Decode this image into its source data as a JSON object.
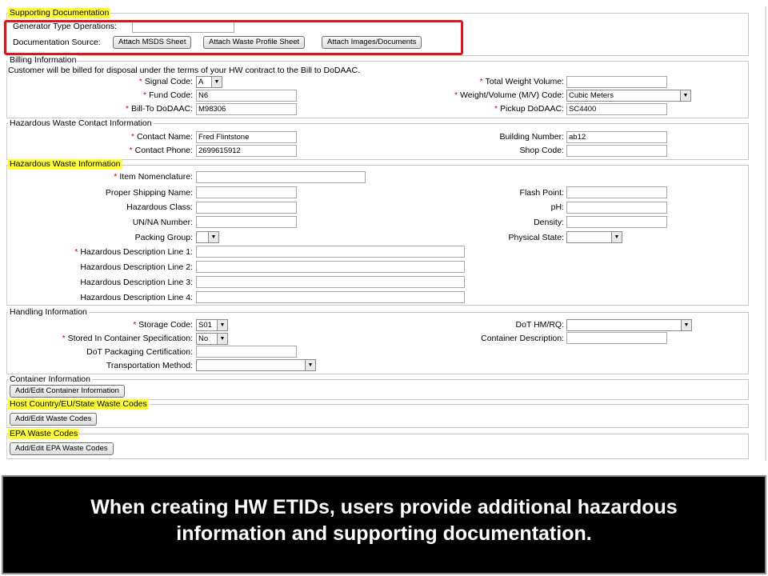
{
  "supporting": {
    "title": "Supporting Documentation",
    "generator_label": "Generator Type Operations:",
    "generator_value": "",
    "doc_source_label": "Documentation Source:",
    "attach_msds": "Attach MSDS Sheet",
    "attach_waste_profile": "Attach Waste Profile Sheet",
    "attach_images": "Attach Images/Documents"
  },
  "billing": {
    "title": "Billing Information",
    "note": "Customer will be billed for disposal under the terms of your HW contract to the Bill to DoDAAC.",
    "signal_code_label": "Signal Code:",
    "signal_code_value": "A",
    "fund_code_label": "Fund Code:",
    "fund_code_value": "N6",
    "bill_to_label": "Bill-To DoDAAC:",
    "bill_to_value": "M98306",
    "total_weight_label": "Total Weight Volume:",
    "total_weight_value": "",
    "weight_code_label": "Weight/Volume (M/V) Code:",
    "weight_code_value": "Cubic Meters",
    "pickup_label": "Pickup DoDAAC:",
    "pickup_value": "SC4400"
  },
  "contact": {
    "title": "Hazardous Waste Contact Information",
    "name_label": "Contact Name:",
    "name_value": "Fred Flintstone",
    "phone_label": "Contact Phone:",
    "phone_value": "2699615912",
    "building_label": "Building Number:",
    "building_value": "ab12",
    "shop_label": "Shop Code:",
    "shop_value": ""
  },
  "hw_info": {
    "title": "Hazardous Waste Information",
    "item_nomenclature_label": "Item Nomenclature:",
    "proper_shipping_label": "Proper Shipping Name:",
    "hazardous_class_label": "Hazardous Class:",
    "un_na_label": "UN/NA Number:",
    "packing_group_label": "Packing Group:",
    "desc1_label": "Hazardous Description Line 1:",
    "desc2_label": "Hazardous Description Line 2:",
    "desc3_label": "Hazardous Description Line 3:",
    "desc4_label": "Hazardous Description Line 4:",
    "flash_point_label": "Flash Point:",
    "ph_label": "pH:",
    "density_label": "Density:",
    "physical_state_label": "Physical State:"
  },
  "handling": {
    "title": "Handling Information",
    "storage_code_label": "Storage Code:",
    "storage_code_value": "S01",
    "stored_in_container_label": "Stored In Container Specification:",
    "stored_in_container_value": "No",
    "dot_packaging_label": "DoT Packaging Certification:",
    "transport_method_label": "Transportation Method:",
    "dot_hmrq_label": "DoT HM/RQ:",
    "container_desc_label": "Container Description:"
  },
  "container": {
    "title": "Container Information",
    "button": "Add/Edit Container Information"
  },
  "host_country": {
    "title": "Host Country/EU/State Waste Codes",
    "button": "Add/Edit Waste Codes"
  },
  "epa": {
    "title": "EPA Waste Codes",
    "button": "Add/Edit EPA Waste Codes"
  },
  "caption": {
    "line1": "When creating HW ETIDs, users provide additional hazardous",
    "line2": "information and supporting documentation."
  },
  "colors": {
    "highlight": "#ffff33",
    "required_star": "#e00000",
    "callout_border": "#e0141e",
    "caption_bg": "#000000"
  }
}
